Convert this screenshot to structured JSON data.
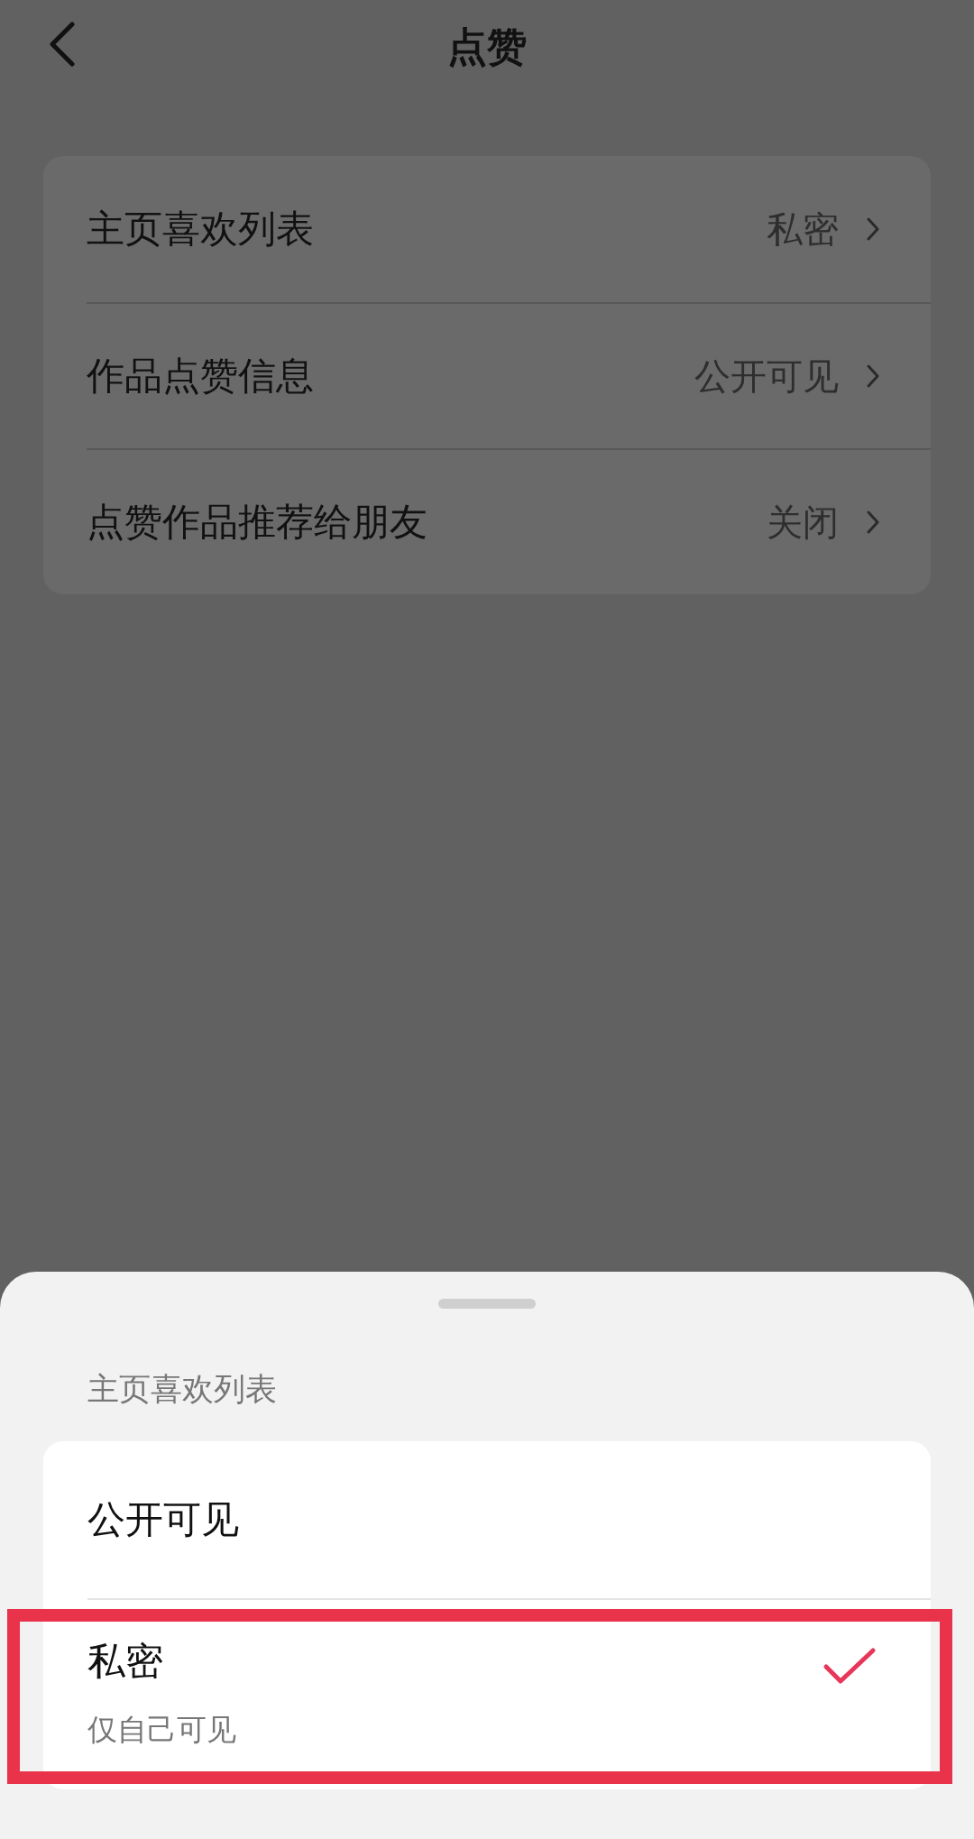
{
  "header": {
    "title": "点赞"
  },
  "settings": [
    {
      "label": "主页喜欢列表",
      "value": "私密"
    },
    {
      "label": "作品点赞信息",
      "value": "公开可见"
    },
    {
      "label": "点赞作品推荐给朋友",
      "value": "关闭"
    }
  ],
  "sheet": {
    "title": "主页喜欢列表",
    "options": [
      {
        "label": "公开可见",
        "selected": false,
        "highlighted": false
      },
      {
        "label": "私密",
        "description": "仅自己可见",
        "selected": true,
        "highlighted": true
      }
    ]
  }
}
